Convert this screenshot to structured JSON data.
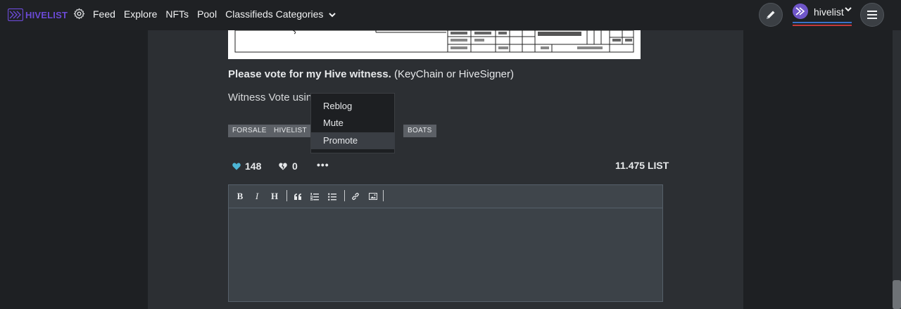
{
  "header": {
    "logo_text": "HIVELIST",
    "nav": [
      "Feed",
      "Explore",
      "NFTs",
      "Pool",
      "Classifieds Categories"
    ],
    "username": "hivelist"
  },
  "post": {
    "witness_bold": "Please vote for my Hive witness.",
    "witness_rest": " (KeyChain or HiveSigner)",
    "vote_prefix": "Witness Vote using",
    "tags": [
      "FORSALE",
      "HIVELIST",
      "BOATS"
    ]
  },
  "dropdown": {
    "items": [
      "Reblog",
      "Mute",
      "Promote"
    ]
  },
  "actions": {
    "upvotes": "148",
    "downvotes": "0",
    "more": "•••",
    "payout": "11.475 LIST"
  },
  "editor": {
    "toolbar": [
      "B",
      "I",
      "H"
    ]
  },
  "colors": {
    "accent": "#6b4ad6",
    "upvote": "#4db6d6"
  }
}
